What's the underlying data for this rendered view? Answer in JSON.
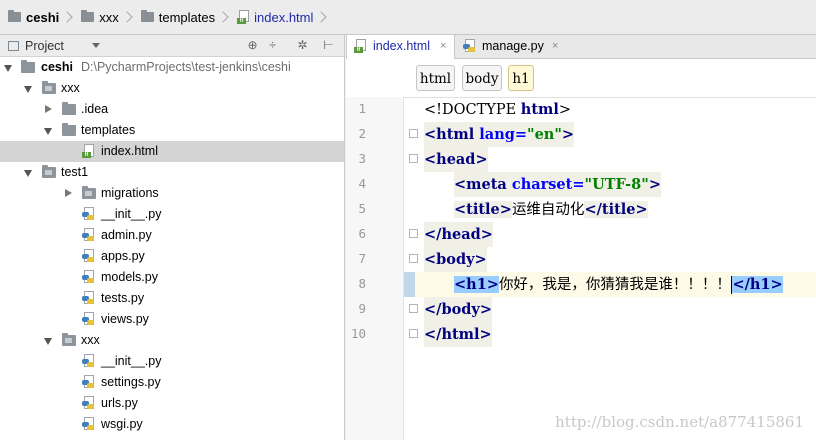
{
  "breadcrumb": {
    "items": [
      "ceshi",
      "xxx",
      "templates",
      "index.html"
    ]
  },
  "project_panel": {
    "title": "Project"
  },
  "tree": {
    "root": {
      "name": "ceshi",
      "path": "D:\\PycharmProjects\\test-jenkins\\ceshi"
    },
    "items": [
      {
        "name": "xxx"
      },
      {
        "name": ".idea"
      },
      {
        "name": "templates"
      },
      {
        "name": "index.html"
      },
      {
        "name": "test1"
      },
      {
        "name": "migrations"
      },
      {
        "name": "__init__.py"
      },
      {
        "name": "admin.py"
      },
      {
        "name": "apps.py"
      },
      {
        "name": "models.py"
      },
      {
        "name": "tests.py"
      },
      {
        "name": "views.py"
      },
      {
        "name": "xxx"
      },
      {
        "name": "__init__.py"
      },
      {
        "name": "settings.py"
      },
      {
        "name": "urls.py"
      },
      {
        "name": "wsgi.py"
      }
    ]
  },
  "tabs": [
    {
      "label": "index.html",
      "close": "×"
    },
    {
      "label": "manage.py",
      "close": "×"
    }
  ],
  "tag_path": [
    "html",
    "body",
    "h1"
  ],
  "editor": {
    "line_numbers": [
      "1",
      "2",
      "3",
      "4",
      "5",
      "6",
      "7",
      "8",
      "9",
      "10"
    ],
    "code": {
      "l1_a": "<!DOCTYPE ",
      "l1_b": "html",
      "l1_c": ">",
      "l2_a": "<html ",
      "l2_b": "lang=",
      "l2_c": "\"en\"",
      "l2_d": ">",
      "l3": "<head>",
      "l4_a": "<meta ",
      "l4_b": "charset=",
      "l4_c": "\"UTF-8\"",
      "l4_d": ">",
      "l5_a": "<title>",
      "l5_b": "运维自动化",
      "l5_c": "</title>",
      "l6": "</head>",
      "l7": "<body>",
      "l8_a": "<h1>",
      "l8_b": "你好，我是，你猜猜我是谁！！！！",
      "l8_c": "</h1>",
      "l9": "</body>",
      "l10": "</html>"
    }
  },
  "watermark": "http://blog.csdn.net/a877415861"
}
